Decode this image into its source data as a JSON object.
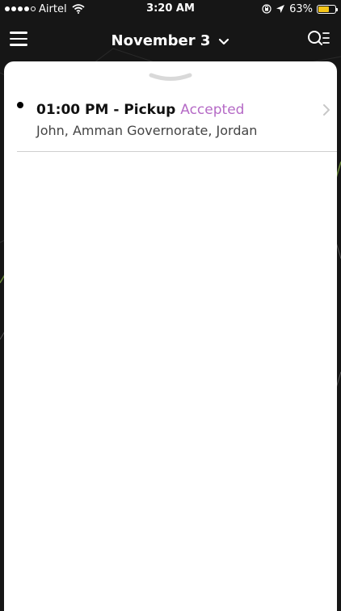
{
  "status_bar": {
    "carrier": "Airtel",
    "time": "3:20 AM",
    "battery": "63%",
    "battery_fraction": 0.63,
    "battery_color": "#f5c518",
    "icons": [
      "signal-dots",
      "wifi-icon",
      "orientation-lock-icon",
      "location-arrow-icon",
      "battery-icon"
    ]
  },
  "nav": {
    "date": "November 3",
    "icons": [
      "hamburger-menu-icon",
      "chevron-down-icon",
      "search-filter-icon"
    ]
  },
  "schedule": {
    "items": [
      {
        "title": "01:00 PM - Pickup",
        "status": "Accepted",
        "subtitle": "John, Amman Governorate, Jordan"
      }
    ]
  },
  "colors": {
    "status_accepted": "#b56ac6",
    "background": "#161616",
    "sheet": "#ffffff"
  }
}
